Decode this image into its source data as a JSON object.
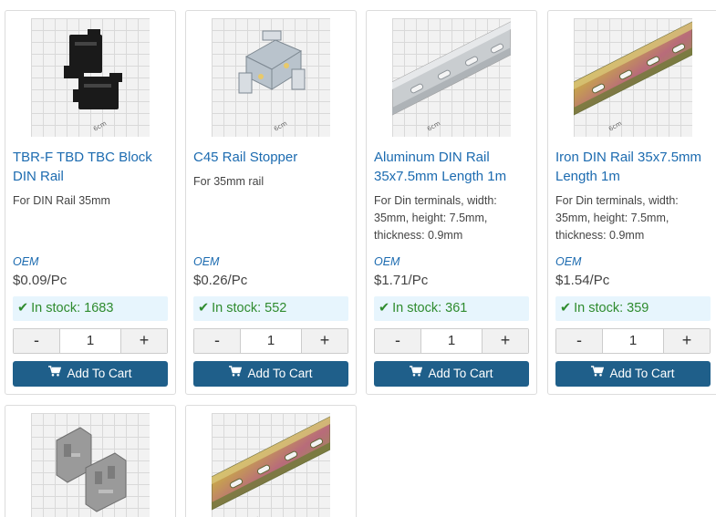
{
  "products": [
    {
      "title": "TBR-F TBD TBC Block DIN Rail",
      "description": "For DIN Rail 35mm",
      "brand": "OEM",
      "price": "$0.09/Pc",
      "stock": "In stock: 1683",
      "quantity": "1",
      "decrement": "-",
      "increment": "+",
      "cart_label": "Add To Cart",
      "image_icon": "black-block-bracket-image"
    },
    {
      "title": "C45 Rail Stopper",
      "description": "For 35mm rail",
      "brand": "OEM",
      "price": "$0.26/Pc",
      "stock": "In stock: 552",
      "quantity": "1",
      "decrement": "-",
      "increment": "+",
      "cart_label": "Add To Cart",
      "image_icon": "metal-rail-stopper-image"
    },
    {
      "title": "Aluminum DIN Rail 35x7.5mm Length 1m",
      "description": "For Din terminals, width: 35mm, height: 7.5mm, thickness: 0.9mm",
      "brand": "OEM",
      "price": "$1.71/Pc",
      "stock": "In stock: 361",
      "quantity": "1",
      "decrement": "-",
      "increment": "+",
      "cart_label": "Add To Cart",
      "image_icon": "aluminum-din-rail-image"
    },
    {
      "title": "Iron DIN Rail 35x7.5mm Length 1m",
      "description": "For Din terminals, width: 35mm, height: 7.5mm, thickness: 0.9mm",
      "brand": "OEM",
      "price": "$1.54/Pc",
      "stock": "In stock: 359",
      "quantity": "1",
      "decrement": "-",
      "increment": "+",
      "cart_label": "Add To Cart",
      "image_icon": "iron-din-rail-image"
    },
    {
      "image_icon": "grey-end-clamp-image"
    },
    {
      "image_icon": "iron-din-rail-image"
    }
  ],
  "colors": {
    "link": "#1c6bb0",
    "stock_text": "#2e8b2e",
    "stock_bg": "#e7f5fd",
    "cart_button": "#1f5f8a"
  },
  "scale_label": "6cm"
}
